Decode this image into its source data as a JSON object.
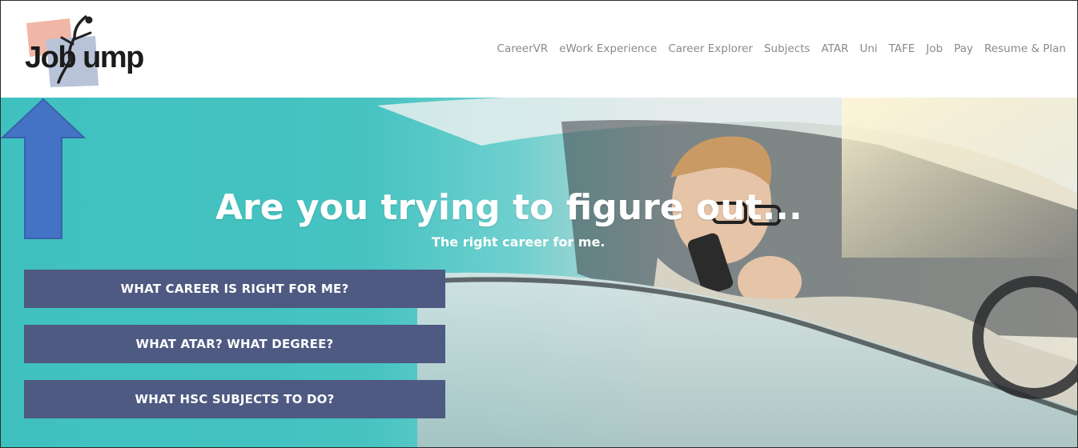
{
  "brand": {
    "name": "JobJump",
    "logo_text": "Job ump"
  },
  "nav": {
    "items": [
      {
        "label": "CareerVR"
      },
      {
        "label": "eWork Experience"
      },
      {
        "label": "Career Explorer"
      },
      {
        "label": "Subjects"
      },
      {
        "label": "ATAR"
      },
      {
        "label": "Uni"
      },
      {
        "label": "TAFE"
      },
      {
        "label": "Job"
      },
      {
        "label": "Pay"
      },
      {
        "label": "Resume & Plan"
      }
    ]
  },
  "hero": {
    "headline": "Are you trying to figure out...",
    "subline": "The right career for me.",
    "buttons": [
      {
        "label": "WHAT CAREER IS RIGHT FOR ME?"
      },
      {
        "label": "WHAT ATAR? WHAT DEGREE?"
      },
      {
        "label": "WHAT HSC SUBJECTS TO DO?"
      }
    ]
  },
  "annotation": {
    "arrow_target": "Subjects",
    "arrow_color": "#4472c4"
  },
  "colors": {
    "accent_teal": "#3fc1c0",
    "button_bg": "#4e5a82",
    "nav_text": "#8a8a8a"
  }
}
